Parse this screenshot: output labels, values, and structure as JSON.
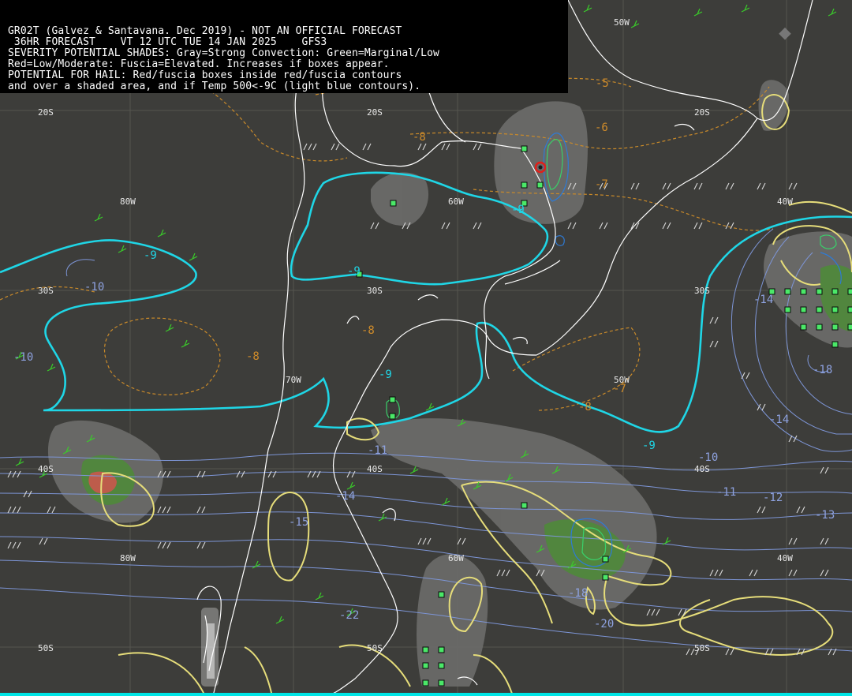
{
  "header": {
    "line1": "GR02T (Galvez & Santavana. Dec 2019) - NOT AN OFFICIAL FORECAST",
    "line2": " 36HR FORECAST    VT 12 UTC TUE 14 JAN 2025    GFS3",
    "line3": "SEVERITY POTENTIAL SHADES: Gray=Strong Convection: Green=Marginal/Low",
    "line4": "Red=Low/Moderate: Fuscia=Elevated. Increases if boxes appear.",
    "line5": "POTENTIAL FOR HAIL: Red/fuscia boxes inside red/fuscia contours",
    "line6": "and over a shaded area, and if Temp 500<-9C (light blue contours)."
  },
  "grid_labels": {
    "lat_20s_a": "20S",
    "lat_20s_b": "20S",
    "lat_20s_c": "20S",
    "lat_30s_a": "30S",
    "lat_30s_b": "30S",
    "lat_30s_c": "30S",
    "lat_40s_a": "40S",
    "lat_40s_b": "40S",
    "lat_40s_c": "40S",
    "lat_50s_a": "50S",
    "lat_50s_b": "50S",
    "lat_50s_c": "50S",
    "lon_80w_a": "80W",
    "lon_80w_b": "80W",
    "lon_70w": "70W",
    "lon_60w_a": "60W",
    "lon_60w_b": "60W",
    "lon_50w_a": "50W",
    "lon_50w_b": "50W",
    "lon_40w_a": "40W",
    "lon_40w_b": "40W"
  },
  "temp_labels": {
    "t1": "-9",
    "t2": "-9",
    "t3": "-9",
    "t4": "-9",
    "t5": "-9",
    "t6": "-10",
    "t7": "-10",
    "t8": "-10",
    "t9": "-11",
    "t10": "-11",
    "t11": "-12",
    "t12": "-13",
    "t13": "-14",
    "t14": "-14",
    "t15": "-14",
    "t16": "-15",
    "t17": "-18",
    "t18": "-18",
    "t19": "-20",
    "t20": "-22"
  },
  "thickness_labels": {
    "k1": "-5",
    "k2": "-6",
    "k3": "-7",
    "k4": "-8",
    "k5": "-8",
    "k6": "-8",
    "k7": "-8",
    "k8": "-7"
  },
  "colors": {
    "background": "#3d3d3a",
    "temp_500_minus9": "#1fd6e6",
    "temp_isotherm": "#7d95d6",
    "thickness": "#c98a2a",
    "hail_contour": "#e8e07a",
    "shade_gray": "#6c6c6c",
    "shade_green": "#4f8f3a",
    "shade_red": "#c9584c",
    "box_green": "#4be868",
    "coast": "#ffffff",
    "wind_barb_green": "#3acb2a",
    "wind_barb_white": "#d8d8d8"
  }
}
